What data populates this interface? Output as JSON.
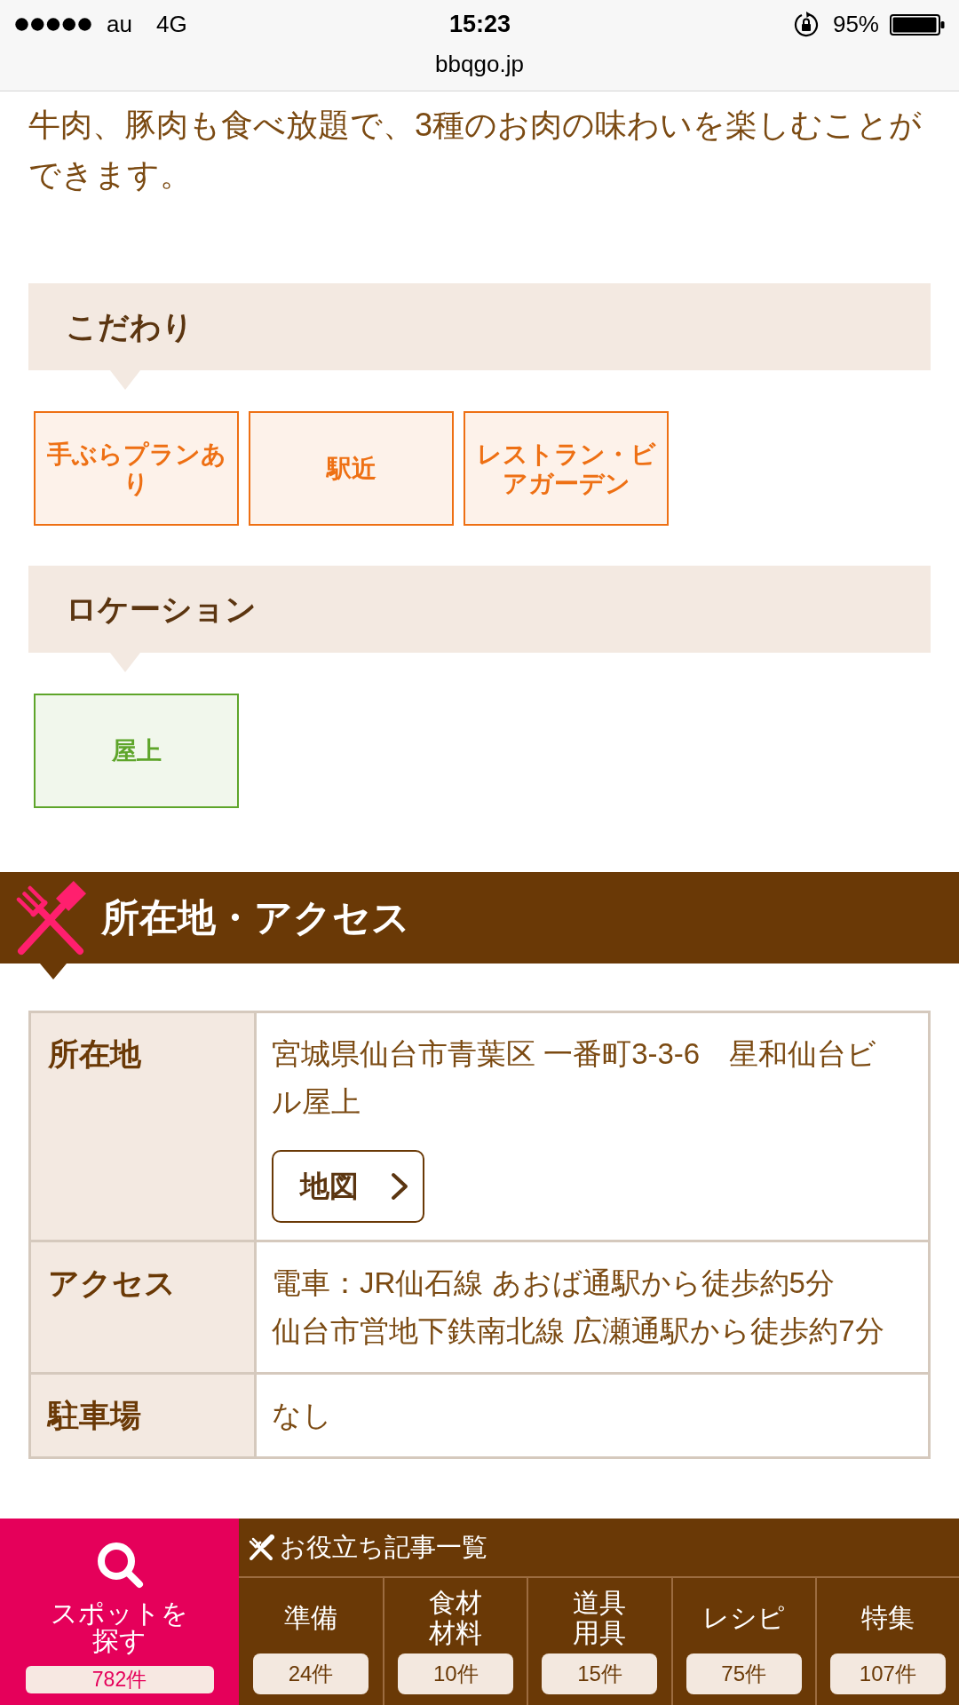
{
  "status_bar": {
    "carrier": "au",
    "network": "4G",
    "time": "15:23",
    "battery": "95%",
    "url": "bbqgo.jp"
  },
  "intro": "牛肉、豚肉も食べ放題で、3種のお肉の味わいを楽しむことができます。",
  "feature_groups": [
    {
      "title": "こだわり",
      "color": "#ee7014",
      "tags": [
        "手ぶらプランあり",
        "駅近",
        "レストラン・ビアガーデン"
      ]
    },
    {
      "title": "ロケーション",
      "color": "#5ea52a",
      "tags": [
        "屋上"
      ]
    }
  ],
  "access_section": {
    "title": "所在地・アクセス",
    "rows": [
      {
        "label": "所在地",
        "lines": [
          "宮城県仙台市青葉区 一番町3-3-6　星和仙台ビル屋上"
        ],
        "button": "地図"
      },
      {
        "label": "アクセス",
        "lines": [
          "電車：JR仙石線 あおば通駅から徒歩約5分",
          "仙台市営地下鉄南北線 広瀬通駅から徒歩約7分"
        ]
      },
      {
        "label": "駐車場",
        "lines": [
          "なし"
        ]
      }
    ]
  },
  "bottom_nav": {
    "search": {
      "label_lines": [
        "スポットを",
        "探す"
      ],
      "count": "782件"
    },
    "articles": {
      "title": "お役立ち記事一覧",
      "categories": [
        {
          "label_lines": [
            "準備"
          ],
          "count": "24件"
        },
        {
          "label_lines": [
            "食材",
            "材料"
          ],
          "count": "10件"
        },
        {
          "label_lines": [
            "道具",
            "用具"
          ],
          "count": "15件"
        },
        {
          "label_lines": [
            "レシピ"
          ],
          "count": "75件"
        },
        {
          "label_lines": [
            "特集"
          ],
          "count": "107件"
        }
      ]
    }
  }
}
